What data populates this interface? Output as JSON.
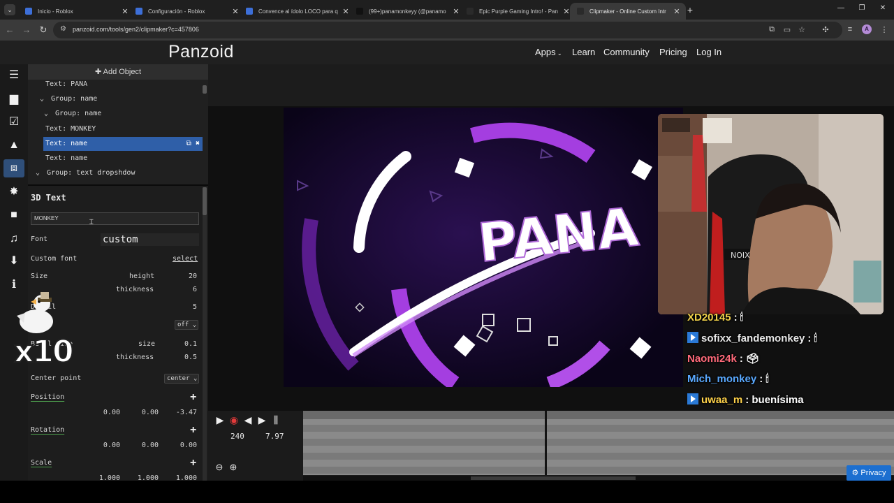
{
  "browser": {
    "tabs": [
      {
        "title": "Inicio - Roblox",
        "color": "#3d6fd8"
      },
      {
        "title": "Configuración - Roblox",
        "color": "#3d6fd8"
      },
      {
        "title": "Convence al ídolo LOCO para q",
        "color": "#3d6fd8"
      },
      {
        "title": "(99+)panamonkeyy (@panamo",
        "color": "#111111"
      },
      {
        "title": "Epic Purple Gaming Intro! - Pan",
        "color": "#2a2a2a"
      },
      {
        "title": "Clipmaker - Online Custom Intr",
        "color": "#2a2a2a"
      }
    ],
    "active_tab": 5,
    "url": "panzoid.com/tools/gen2/clipmaker?c=457806",
    "profile_initial": "A"
  },
  "site": {
    "logo": "Panzoid",
    "nav": [
      "Apps",
      "Learn",
      "Community",
      "Pricing",
      "Log In"
    ]
  },
  "rail_icons": [
    "menu-icon",
    "folder-icon",
    "checkbox-icon",
    "image-icon",
    "cube-icon",
    "burst-icon",
    "camera-icon",
    "music-icon",
    "download-icon",
    "info-icon"
  ],
  "tree": {
    "add_object": "Add Object",
    "rows": [
      {
        "label": "Text: PANA",
        "chevron": false
      },
      {
        "label": "Group: name",
        "chevron": true
      },
      {
        "label": "Group: name",
        "chevron": true
      },
      {
        "label": "Text: MONKEY",
        "chevron": false
      },
      {
        "label": "Text: name",
        "chevron": false,
        "selected": true
      },
      {
        "label": "Text: name",
        "chevron": false
      },
      {
        "label": "Group: text dropshdow",
        "chevron": true
      }
    ]
  },
  "props": {
    "title": "3D Text",
    "text_value": "MONKEY",
    "font_label": "Font",
    "font_value": "custom",
    "custom_font_label": "Custom font",
    "custom_font_link": "select",
    "size_label": "Size",
    "height_label": "height",
    "height_value": "20",
    "thickness_label": "thickness",
    "thickness_value": "6",
    "detail_label": "Detail",
    "detail_value": "5",
    "off_select": "off",
    "bevel_label": "Bevel size",
    "bevel_size_label": "size",
    "bevel_size_value": "0.1",
    "bevel_thickness_label": "thickness",
    "bevel_thickness_value": "0.5",
    "center_label": "Center point",
    "center_select": "center",
    "position_label": "Position",
    "position": [
      "0.00",
      "0.00",
      "-3.47"
    ],
    "rotation_label": "Rotation",
    "rotation": [
      "0.00",
      "0.00",
      "0.00"
    ],
    "scale_label": "Scale",
    "scale": [
      "1.000",
      "1.000",
      "1.000"
    ]
  },
  "overlay": {
    "multiplier": "x10"
  },
  "preview": {
    "word": "PANA",
    "accent": "#a43ee0",
    "bg": "#0e0620"
  },
  "chat": [
    {
      "user": "XD20145",
      "msg": ": 🕯",
      "color": "#f0d14a",
      "badge": false
    },
    {
      "user": "sofixx_fandemonkey",
      "msg": ": 🕯",
      "color": "#e8e8e8",
      "badge": true
    },
    {
      "user": "Naomi24k",
      "msg": ": 🗳",
      "color": "#ff6a7a",
      "badge": false
    },
    {
      "user": "Mich_monkey",
      "msg": ": 🕯",
      "color": "#5aa9ff",
      "badge": false
    },
    {
      "user": "uwaa_m",
      "msg": ": buenísima",
      "color": "#ffd24a",
      "badge": true
    }
  ],
  "timeline": {
    "frame": "240",
    "seconds": "7.97"
  },
  "privacy": "Privacy"
}
